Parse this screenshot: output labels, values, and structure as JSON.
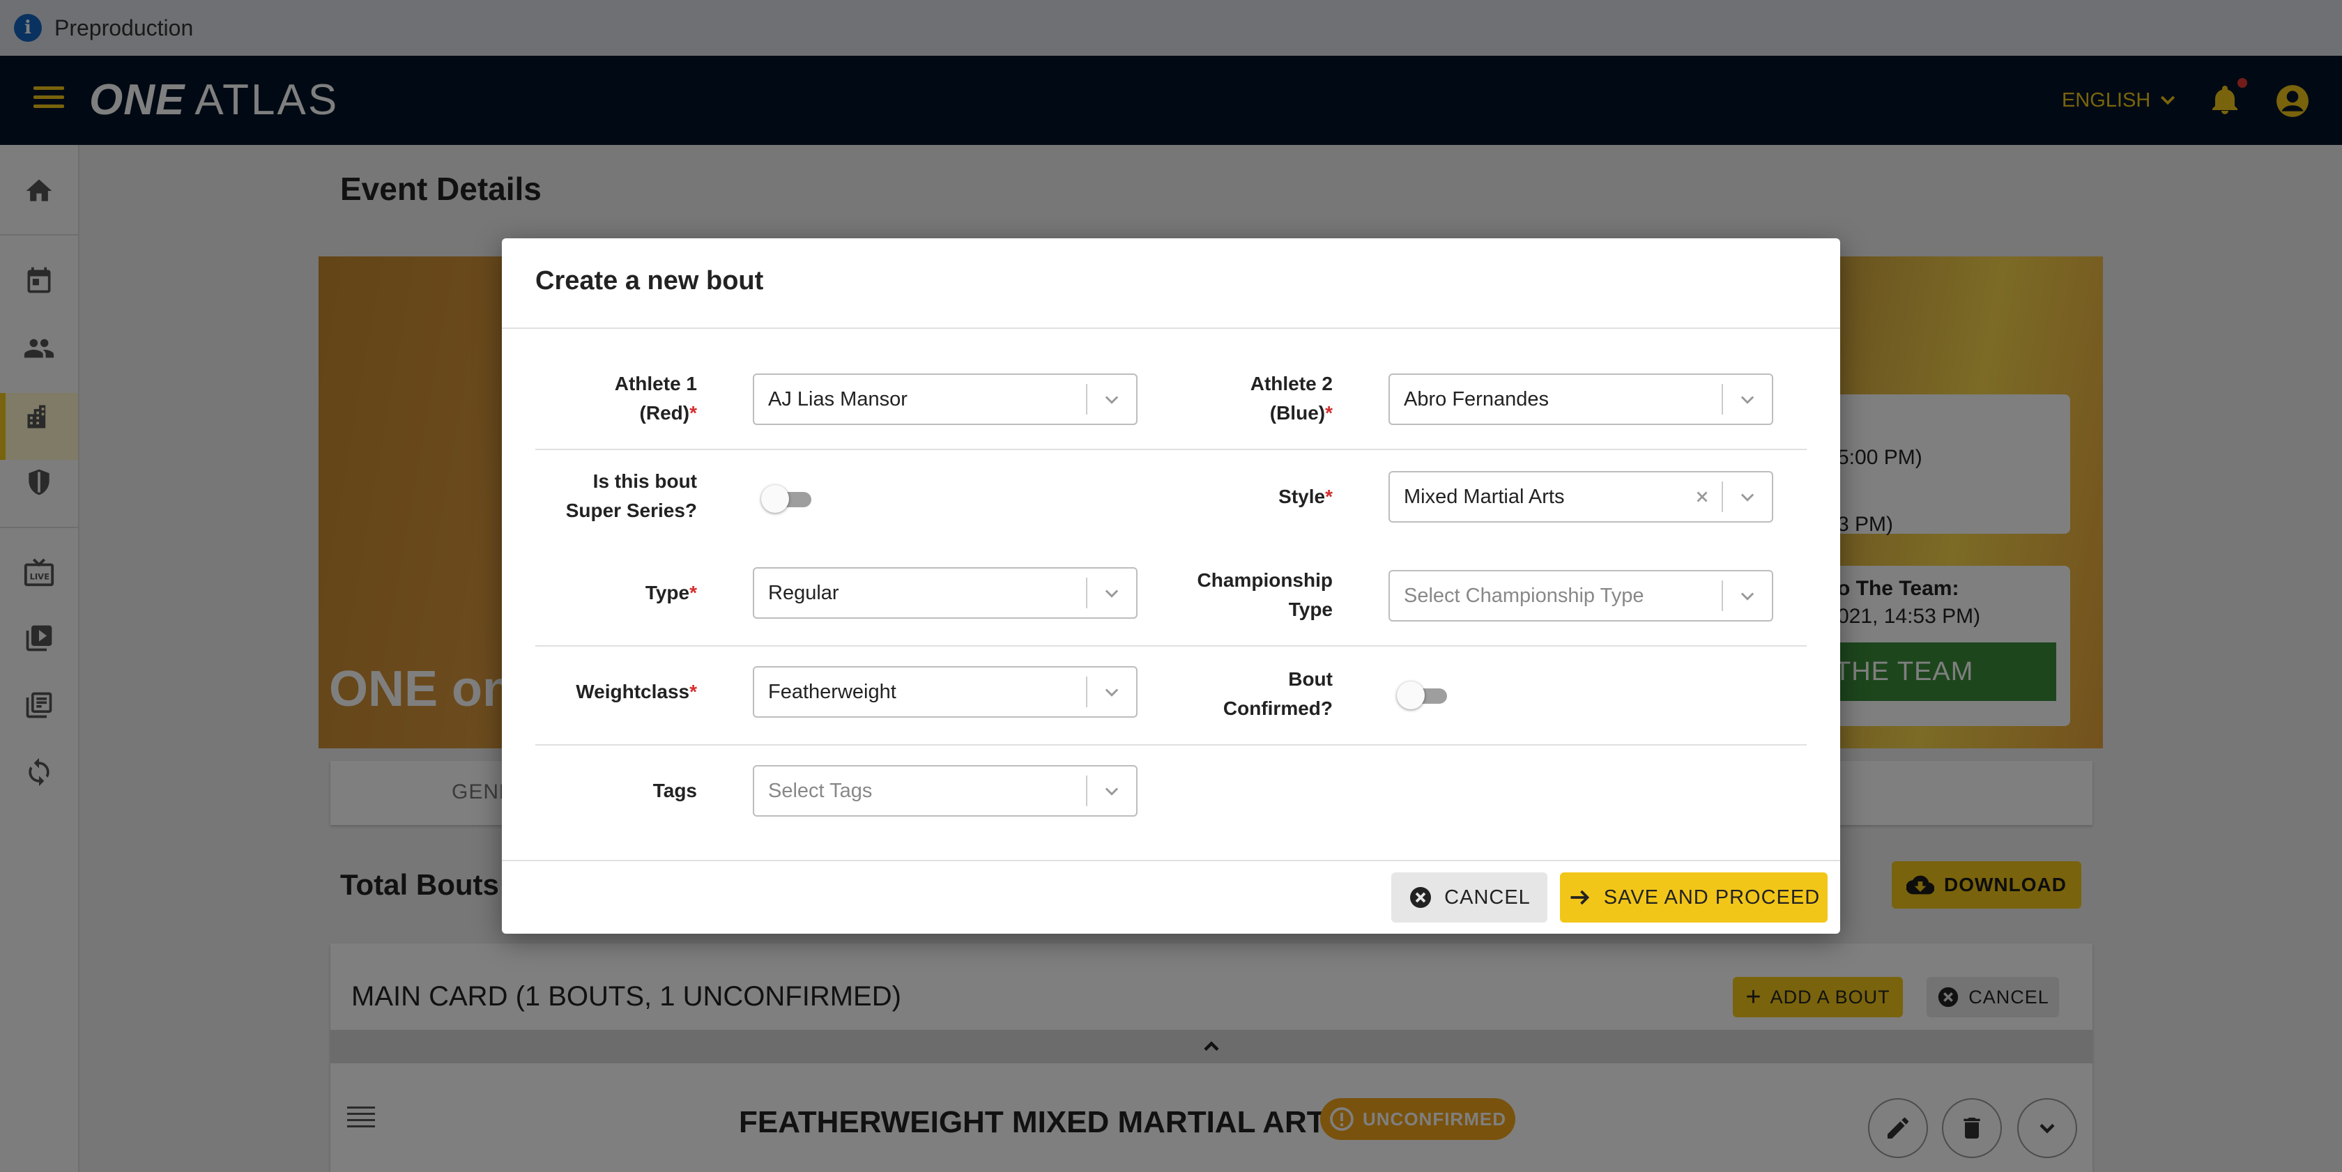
{
  "env_banner": {
    "text": "Preproduction"
  },
  "appbar": {
    "logo_one": "ONE",
    "logo_atlas": "ATLAS",
    "language": "ENGLISH"
  },
  "page": {
    "title": "Event Details",
    "banner_text": "ONE on",
    "panel": {
      "line1": "5:00 PM)",
      "line2": "3 PM)",
      "line3": "o The Team:",
      "line4": "021, 14:53 PM)",
      "button": "THE TEAM"
    },
    "tab_general": "GENE",
    "total_bouts": "Total Bouts:",
    "download": "DOWNLOAD",
    "main_card": {
      "title": "MAIN CARD (1 BOUTS, 1 UNCONFIRMED)",
      "add_bout": "ADD A BOUT",
      "cancel": "CANCEL",
      "bout_title": "FEATHERWEIGHT  MIXED MARTIAL ARTS",
      "badge": "UNCONFIRMED"
    }
  },
  "modal": {
    "title": "Create a new bout",
    "athlete1": {
      "label_line1": "Athlete 1",
      "label_line2": "(Red)",
      "required": "*",
      "value": "AJ Lias Mansor"
    },
    "athlete2": {
      "label_line1": "Athlete 2",
      "label_line2": "(Blue)",
      "required": "*",
      "value": "Abro Fernandes"
    },
    "super_series": {
      "label_line1": "Is this bout",
      "label_line2": "Super Series?",
      "checked": false
    },
    "style": {
      "label": "Style",
      "required": "*",
      "value": "Mixed Martial Arts"
    },
    "type": {
      "label": "Type",
      "required": "*",
      "value": "Regular"
    },
    "championship": {
      "label_line1": "Championship",
      "label_line2": "Type",
      "placeholder": "Select Championship Type"
    },
    "weightclass": {
      "label": "Weightclass",
      "required": "*",
      "value": "Featherweight"
    },
    "confirmed": {
      "label_line1": "Bout",
      "label_line2": "Confirmed?",
      "checked": false
    },
    "tags": {
      "label": "Tags",
      "placeholder": "Select Tags"
    },
    "cancel": "CANCEL",
    "save": "SAVE AND PROCEED"
  },
  "colors": {
    "accent": "#f2c618",
    "appbar": "#031528",
    "required": "#d32f2f",
    "badge": "#f2a51a"
  }
}
